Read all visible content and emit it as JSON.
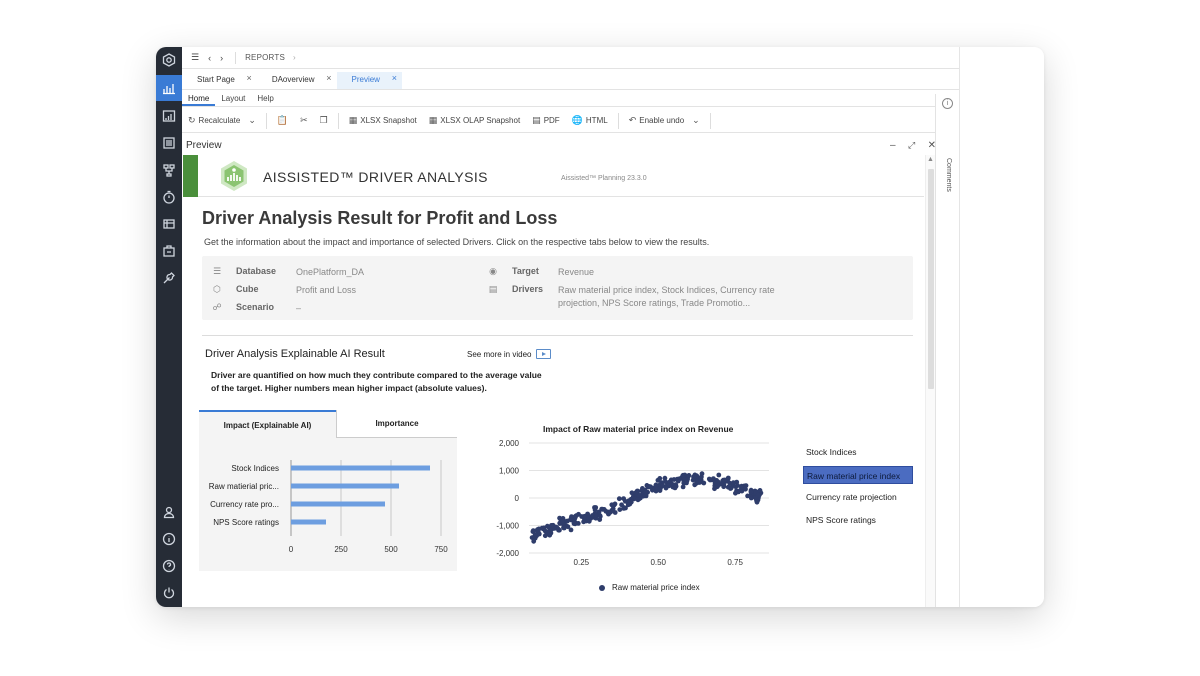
{
  "app": {
    "breadcrumb": "REPORTS",
    "tabs": [
      {
        "label": "Start Page",
        "active": false
      },
      {
        "label": "DAoverview",
        "active": false
      },
      {
        "label": "Preview",
        "active": true
      }
    ],
    "menu": [
      "Home",
      "Layout",
      "Help"
    ],
    "toolbar": {
      "recalculate": "Recalculate",
      "xlsx_snapshot": "XLSX Snapshot",
      "xlsx_olap_snapshot": "XLSX OLAP Snapshot",
      "pdf": "PDF",
      "html": "HTML",
      "enable_undo": "Enable undo"
    },
    "panel_title": "Preview",
    "side_panel_label": "Comments"
  },
  "colors": {
    "accent": "#3a7bd5",
    "rail_bg": "#262c36",
    "banner_green": "#4a8f3b",
    "bar_fill": "#6d9ee0",
    "scatter_dot": "#2f3d6b",
    "legend_selected": "#4b6cc1"
  },
  "report": {
    "banner_title": "AISSISTED™ DRIVER ANALYSIS",
    "version": "Aissisted™ Planning 23.3.0",
    "heading": "Driver Analysis Result for Profit and Loss",
    "subtitle": "Get the information about the impact and importance of selected Drivers. Click on the respective tabs below to view the results.",
    "info": {
      "database_label": "Database",
      "database_value": "OnePlatform_DA",
      "cube_label": "Cube",
      "cube_value": "Profit and Loss",
      "scenario_label": "Scenario",
      "scenario_value": "–",
      "target_label": "Target",
      "target_value": "Revenue",
      "drivers_label": "Drivers",
      "drivers_line1": "Raw material price index, Stock Indices, Currency rate",
      "drivers_line2": "projection, NPS Score ratings, Trade Promotio..."
    },
    "section_title": "Driver Analysis Explainable AI Result",
    "video_link": "See more in video",
    "description_line1": "Driver are quantified on how much they contribute compared to the average value",
    "description_line2": "of the target. Higher numbers mean higher impact (absolute values).",
    "impact_tabs": [
      "Impact (Explainable AI)",
      "Importance"
    ],
    "scatter_title": "Impact of Raw material price index on Revenue",
    "driver_legend": [
      {
        "label": "Stock Indices",
        "selected": false
      },
      {
        "label": "Raw material price index",
        "selected": true
      },
      {
        "label": "Currency rate projection",
        "selected": false
      },
      {
        "label": "NPS Score ratings",
        "selected": false
      }
    ],
    "scatter_legend_label": "Raw material price index"
  },
  "chart_data": [
    {
      "type": "bar",
      "orientation": "horizontal",
      "categories": [
        "Stock Indices",
        "Raw matierial pric...",
        "Currency rate pro...",
        "NPS Score ratings"
      ],
      "values": [
        695,
        540,
        470,
        175
      ],
      "x_ticks": [
        0,
        250,
        500,
        750
      ],
      "xlim": [
        0,
        780
      ],
      "grid": true
    },
    {
      "type": "scatter",
      "title": "Impact of Raw material price index on Revenue",
      "series_name": "Raw material price index",
      "x_ticks": [
        "0.25",
        "0.50",
        "0.75"
      ],
      "y_ticks": [
        "2,000",
        "1,000",
        "0",
        "-1,000",
        "-2,000"
      ],
      "xlim": [
        0.08,
        0.86
      ],
      "ylim": [
        -2000,
        2000
      ],
      "trend_points": [
        [
          0.08,
          -1350
        ],
        [
          0.12,
          -1200
        ],
        [
          0.18,
          -950
        ],
        [
          0.25,
          -750
        ],
        [
          0.32,
          -500
        ],
        [
          0.38,
          -250
        ],
        [
          0.43,
          50
        ],
        [
          0.48,
          350
        ],
        [
          0.53,
          550
        ],
        [
          0.58,
          700
        ],
        [
          0.63,
          720
        ],
        [
          0.68,
          620
        ],
        [
          0.73,
          500
        ],
        [
          0.78,
          300
        ],
        [
          0.83,
          80
        ]
      ],
      "point_count": 320,
      "spread": 230
    }
  ]
}
